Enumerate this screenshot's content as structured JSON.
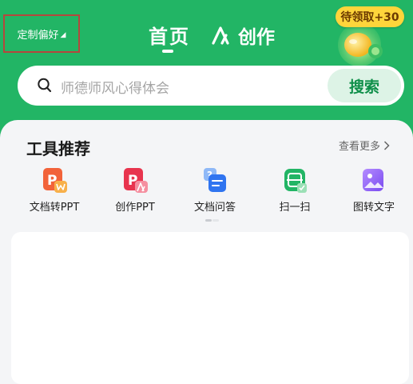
{
  "header": {
    "preference_label": "定制偏好",
    "tabs": [
      {
        "label": "首页",
        "active": true
      },
      {
        "label": "创作",
        "active": false
      }
    ],
    "reward_label": "待领取+30",
    "accent_color": "#22B565"
  },
  "search": {
    "placeholder": "师德师风心得体会",
    "button_label": "搜索"
  },
  "tools_section": {
    "title": "工具推荐",
    "more_label": "查看更多",
    "items": [
      {
        "label": "文档转PPT",
        "icon": "doc-to-ppt-icon"
      },
      {
        "label": "创作PPT",
        "icon": "create-ppt-icon"
      },
      {
        "label": "文档问答",
        "icon": "doc-qa-icon"
      },
      {
        "label": "扫一扫",
        "icon": "scan-icon"
      },
      {
        "label": "图转文字",
        "icon": "image-to-text-icon"
      }
    ]
  }
}
